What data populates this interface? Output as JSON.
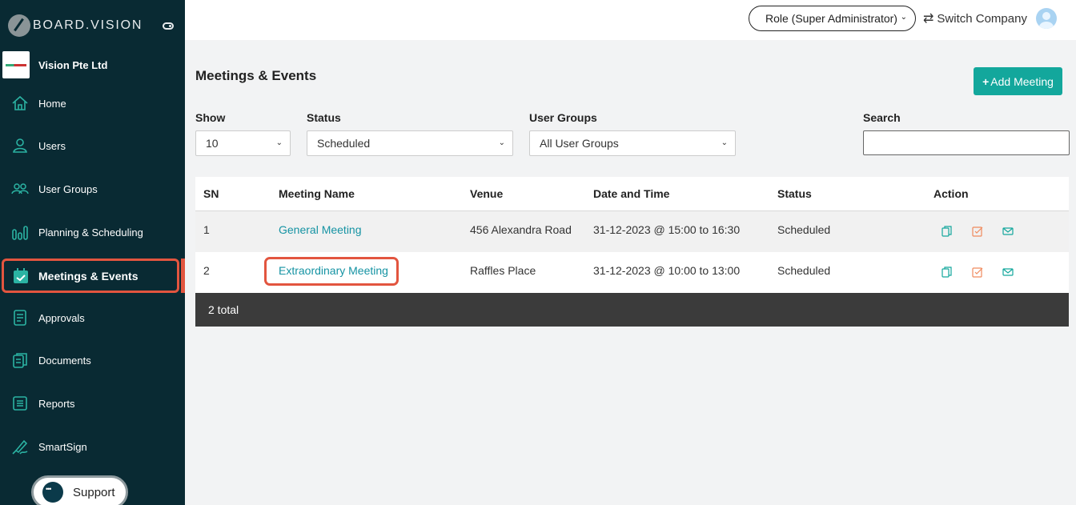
{
  "brand": {
    "name": "BOARD.VISION"
  },
  "company": {
    "name": "Vision Pte Ltd"
  },
  "sidebar": {
    "items": [
      {
        "label": "Home",
        "icon": "home-icon"
      },
      {
        "label": "Users",
        "icon": "user-icon"
      },
      {
        "label": "User Groups",
        "icon": "user-groups-icon"
      },
      {
        "label": "Planning & Scheduling",
        "icon": "bar-chart-icon"
      },
      {
        "label": "Meetings & Events",
        "icon": "calendar-check-icon",
        "active": true
      },
      {
        "label": "Approvals",
        "icon": "document-check-icon"
      },
      {
        "label": "Documents",
        "icon": "documents-icon"
      },
      {
        "label": "Reports",
        "icon": "report-icon"
      },
      {
        "label": "SmartSign",
        "icon": "signature-icon"
      }
    ],
    "support_label": "Support"
  },
  "topbar": {
    "role_label": "Role (Super Administrator)",
    "switch_company_label": "Switch Company"
  },
  "main": {
    "title": "Meetings & Events",
    "add_button_label": "Add Meeting",
    "filters": {
      "show": {
        "label": "Show",
        "value": "10"
      },
      "status": {
        "label": "Status",
        "value": "Scheduled"
      },
      "user_groups": {
        "label": "User Groups",
        "value": "All User Groups"
      },
      "search": {
        "label": "Search",
        "value": ""
      }
    },
    "table": {
      "columns": [
        "SN",
        "Meeting Name",
        "Venue",
        "Date and Time",
        "Status",
        "Action"
      ],
      "rows": [
        {
          "sn": "1",
          "name": "General Meeting",
          "venue": "456 Alexandra Road",
          "datetime": "31-12-2023 @ 15:00 to 16:30",
          "status": "Scheduled"
        },
        {
          "sn": "2",
          "name": "Extraordinary Meeting",
          "venue": "Raffles Place",
          "datetime": "31-12-2023 @ 10:00 to 13:00",
          "status": "Scheduled"
        }
      ],
      "footer": "2 total"
    }
  },
  "colors": {
    "sidebar_bg": "#092a33",
    "accent": "#13a79c",
    "highlight": "#e2553f",
    "link": "#1593a3"
  }
}
